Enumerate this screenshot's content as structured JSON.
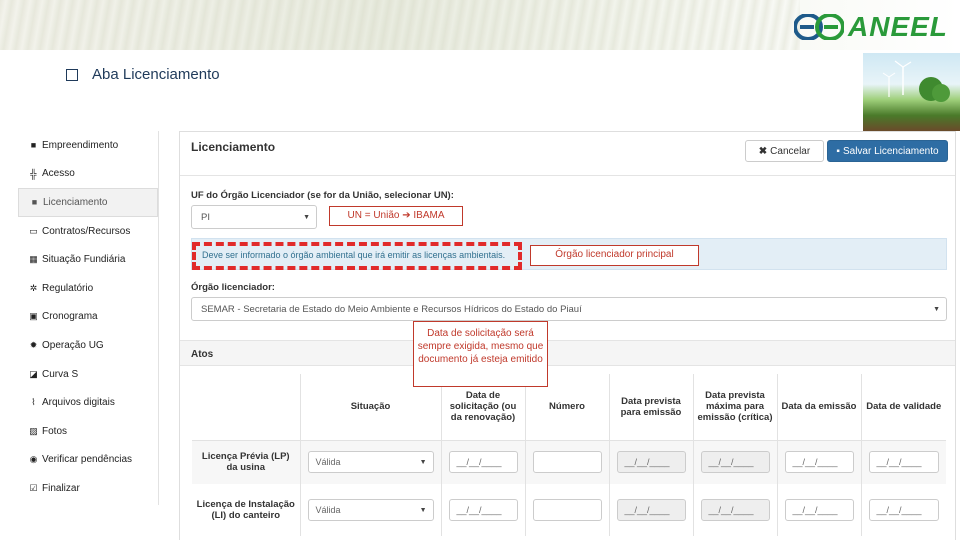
{
  "brand": {
    "name": "ANEEL",
    "accent": "#2a9a3a"
  },
  "slide": {
    "title": "Aba Licenciamento"
  },
  "sidebar": {
    "items": [
      {
        "label": "Empreendimento",
        "icon": "folder-icon"
      },
      {
        "label": "Acesso",
        "icon": "sitemap-icon"
      },
      {
        "label": "Licenciamento",
        "icon": "folder-icon",
        "active": true
      },
      {
        "label": "Contratos/Recursos",
        "icon": "folder-open-icon"
      },
      {
        "label": "Situação Fundiária",
        "icon": "building-icon"
      },
      {
        "label": "Regulatório",
        "icon": "cogs-icon"
      },
      {
        "label": "Cronograma",
        "icon": "calendar-icon"
      },
      {
        "label": "Operação UG",
        "icon": "gear-icon"
      },
      {
        "label": "Curva S",
        "icon": "chart-icon"
      },
      {
        "label": "Arquivos digitais",
        "icon": "paperclip-icon"
      },
      {
        "label": "Fotos",
        "icon": "picture-icon"
      },
      {
        "label": "Verificar pendências",
        "icon": "eye-icon"
      },
      {
        "label": "Finalizar",
        "icon": "check-square-icon"
      }
    ]
  },
  "panel": {
    "title": "Licenciamento",
    "cancel_label": "Cancelar",
    "save_label": "Salvar Licenciamento",
    "uf_label": "UF do Órgão Licenciador (se for da União, selecionar UN):",
    "uf_value": "PI",
    "info_text": "Deve ser informado o órgão ambiental que irá emitir as licenças ambientais.",
    "orgao_label": "Órgão licenciador:",
    "orgao_value": "SEMAR - Secretaria de Estado do Meio Ambiente e Recursos Hídricos do Estado do Piauí",
    "atos_label": "Atos"
  },
  "table": {
    "headers": [
      "",
      "Situação",
      "Data de solicitação (ou da renovação)",
      "Número",
      "Data prevista para emissão",
      "Data prevista máxima para emissão (crítica)",
      "Data da emissão",
      "Data de validade"
    ],
    "rows": [
      {
        "label": "Licença Prévia (LP) da usina",
        "situacao": "Válida",
        "solicitacao": "__/__/____",
        "numero": "",
        "prevista": "__/__/____",
        "maxima": "__/__/____",
        "emissao": "__/__/____",
        "validade": "__/__/____"
      },
      {
        "label": "Licença de Instalação (LI) do canteiro",
        "situacao": "Válida",
        "solicitacao": "__/__/____",
        "numero": "",
        "prevista": "__/__/____",
        "maxima": "__/__/____",
        "emissao": "__/__/____",
        "validade": "__/__/____"
      }
    ]
  },
  "annotations": {
    "un_note": "UN = União ➔ IBAMA",
    "principal_note": "Órgão licenciador principal",
    "solicitacao_note": "Data de solicitação será sempre exigida, mesmo que documento já esteja emitido"
  },
  "colors": {
    "primary_button": "#2e6da4",
    "annotation_red": "#c0392b",
    "info_bg": "#e3eef6"
  }
}
